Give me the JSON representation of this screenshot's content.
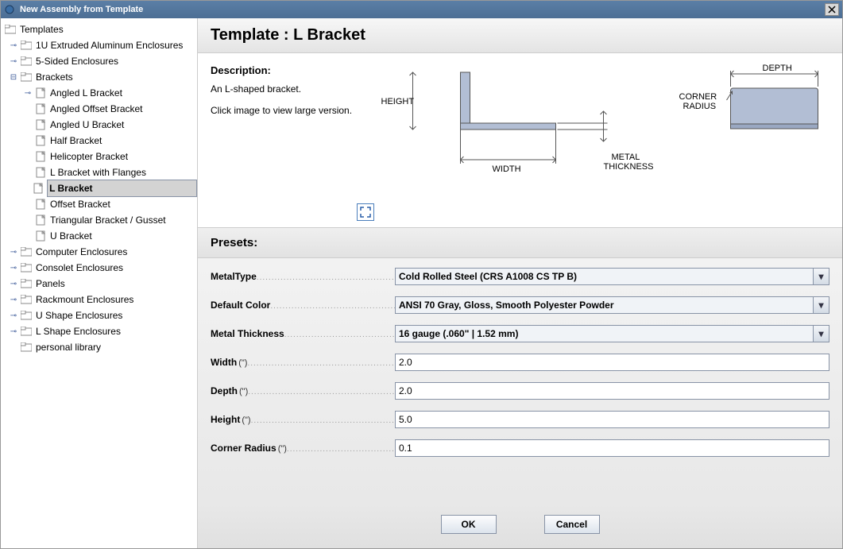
{
  "window": {
    "title": "New Assembly from Template"
  },
  "tree": {
    "root": "Templates",
    "n1": "1U Extruded Aluminum Enclosures",
    "n2": "5-Sided Enclosures",
    "n3": "Brackets",
    "n3_1": "Angled L Bracket",
    "n3_2": "Angled Offset Bracket",
    "n3_3": "Angled U Bracket",
    "n3_4": "Half Bracket",
    "n3_5": "Helicopter Bracket",
    "n3_6": "L Bracket with Flanges",
    "n3_7": "L Bracket",
    "n3_8": "Offset Bracket",
    "n3_9": "Triangular Bracket / Gusset",
    "n3_10": "U Bracket",
    "n4": "Computer Enclosures",
    "n5": "Consolet Enclosures",
    "n6": "Panels",
    "n7": "Rackmount Enclosures",
    "n8": "U Shape Enclosures",
    "n9": "L Shape Enclosures",
    "n10": "personal library"
  },
  "header": {
    "title": "Template : L Bracket"
  },
  "description": {
    "label": "Description:",
    "text1": "An L-shaped bracket.",
    "text2": "Click image to view large version."
  },
  "diagram": {
    "height": "HEIGHT",
    "width": "WIDTH",
    "thickness": "METAL\nTHICKNESS",
    "depth": "DEPTH",
    "corner": "CORNER\nRADIUS"
  },
  "presets": {
    "label": "Presets:"
  },
  "form": {
    "metalType": {
      "label": "MetalType",
      "value": "Cold Rolled Steel (CRS A1008 CS TP B)"
    },
    "defaultColor": {
      "label": "Default Color",
      "value": "ANSI 70 Gray, Gloss, Smooth Polyester Powder"
    },
    "metalThickness": {
      "label": "Metal Thickness",
      "value": "16 gauge (.060\" | 1.52 mm)"
    },
    "width": {
      "label": "Width",
      "unit": "(\")",
      "value": "2.0"
    },
    "depth": {
      "label": "Depth",
      "unit": "(\")",
      "value": "2.0"
    },
    "height": {
      "label": "Height",
      "unit": "(\")",
      "value": "5.0"
    },
    "cornerRadius": {
      "label": "Corner Radius",
      "unit": "(\")",
      "value": "0.1"
    }
  },
  "buttons": {
    "ok": "OK",
    "cancel": "Cancel"
  }
}
